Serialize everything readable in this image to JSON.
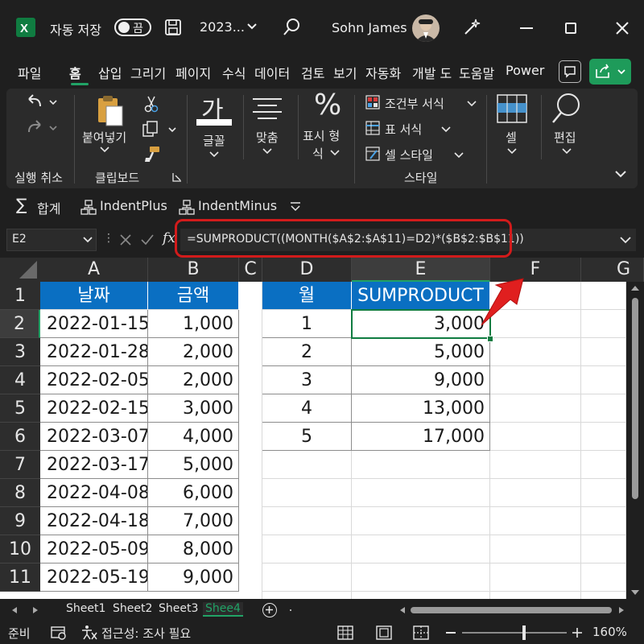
{
  "titlebar": {
    "autosave_label": "자동 저장",
    "autosave_state": "끔",
    "file_name": "2023...",
    "user_name": "Sohn James"
  },
  "menu": {
    "tabs": [
      "파일",
      "홈",
      "삽입",
      "그리기",
      "페이지",
      "수식",
      "데이터",
      "검토",
      "보기",
      "자동화",
      "개발 도",
      "도움말",
      "Power"
    ],
    "active_tab": "홈"
  },
  "ribbon": {
    "undo_group": "실행 취소",
    "paste_label": "붙여넣기",
    "clipboard_group": "클립보드",
    "font_label": "글꼴",
    "font_glyph": "가",
    "align_label": "맞춤",
    "number_label_1": "표시 형",
    "number_label_2": "식",
    "percent_glyph": "%",
    "cond_format": "조건부 서식",
    "table_format": "표 서식",
    "cell_style": "셀 스타일",
    "styles_group": "스타일",
    "cells_label": "셀",
    "edit_label": "편집"
  },
  "qat": {
    "sum": "합계",
    "indent_plus": "IndentPlus",
    "indent_minus": "IndentMinus"
  },
  "formula_bar": {
    "name_box": "E2",
    "fx": "fx",
    "formula": "=SUMPRODUCT((MONTH($A$2:$A$11)=D2)*($B$2:$B$11))"
  },
  "grid": {
    "columns": [
      "A",
      "B",
      "C",
      "D",
      "E",
      "F",
      "G"
    ],
    "rows": [
      "1",
      "2",
      "3",
      "4",
      "5",
      "6",
      "7",
      "8",
      "9",
      "10",
      "11"
    ],
    "selected_cell": "E2",
    "left_table": {
      "headers": [
        "날짜",
        "금액"
      ],
      "rows": [
        [
          "2022-01-15",
          "1,000"
        ],
        [
          "2022-01-28",
          "2,000"
        ],
        [
          "2022-02-05",
          "2,000"
        ],
        [
          "2022-02-15",
          "3,000"
        ],
        [
          "2022-03-07",
          "4,000"
        ],
        [
          "2022-03-17",
          "5,000"
        ],
        [
          "2022-04-08",
          "6,000"
        ],
        [
          "2022-04-18",
          "7,000"
        ],
        [
          "2022-05-09",
          "8,000"
        ],
        [
          "2022-05-19",
          "9,000"
        ]
      ]
    },
    "right_table": {
      "headers": [
        "월",
        "SUMPRODUCT"
      ],
      "rows": [
        [
          "1",
          "3,000"
        ],
        [
          "2",
          "5,000"
        ],
        [
          "3",
          "9,000"
        ],
        [
          "4",
          "13,000"
        ],
        [
          "5",
          "17,000"
        ]
      ]
    }
  },
  "sheets": {
    "tabs": [
      "Sheet1",
      "Sheet2",
      "Sheet3",
      "Shee4"
    ],
    "active": "Shee4"
  },
  "status": {
    "ready": "준비",
    "accessibility": "접근성: 조사 필요",
    "zoom": "160%"
  },
  "colors": {
    "accent_green": "#21a366",
    "header_blue": "#0a6fc2",
    "highlight_red": "#d21b1b"
  }
}
